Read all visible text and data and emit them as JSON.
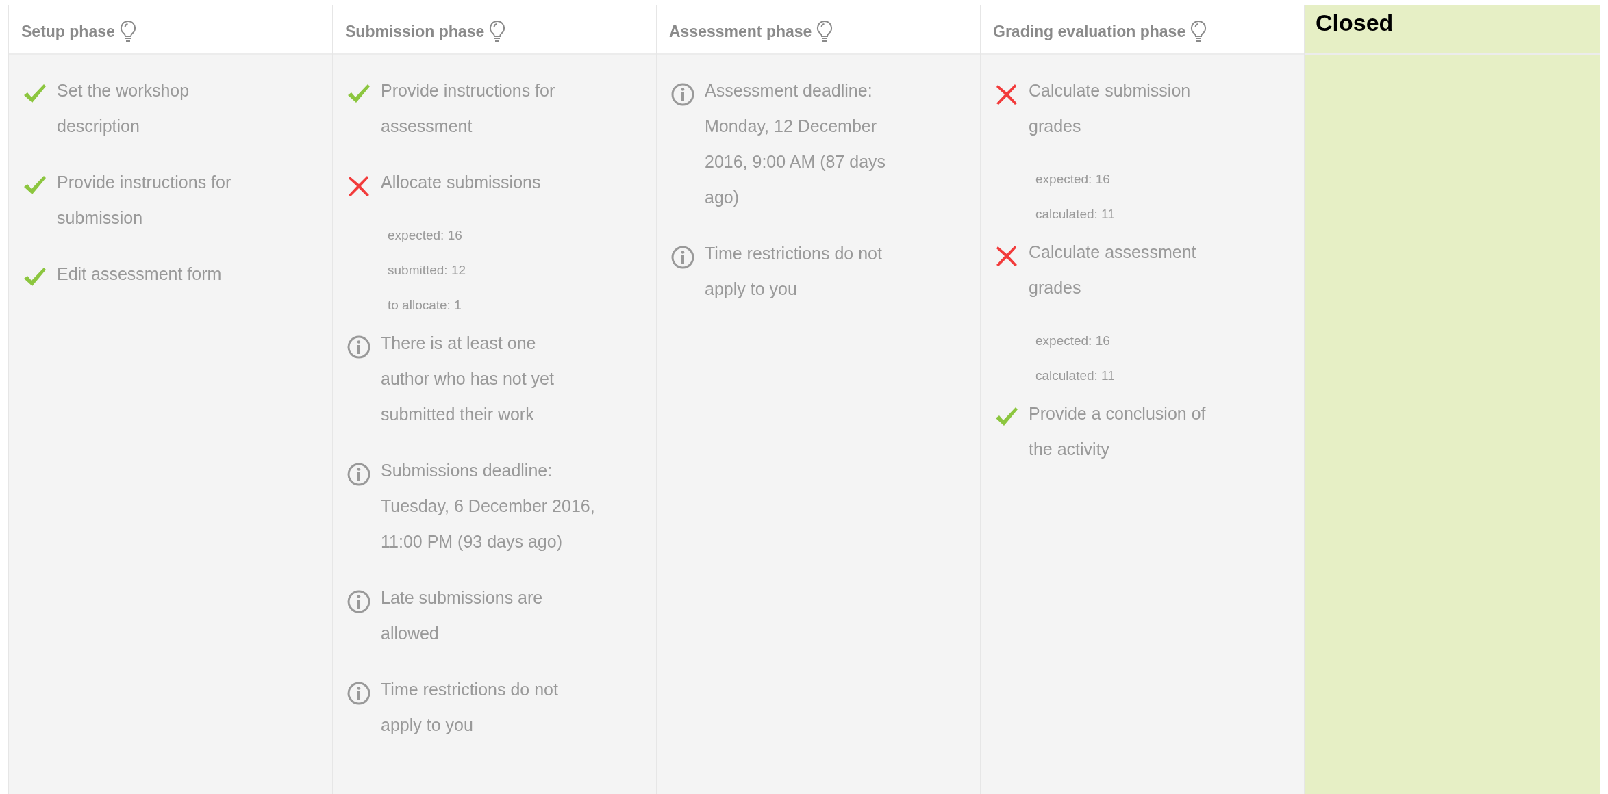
{
  "phases": [
    {
      "title": "Setup phase",
      "current": false,
      "tasks": [
        {
          "kind": "done",
          "text": "Set the workshop\ndescription"
        },
        {
          "kind": "done",
          "text": "Provide instructions for\nsubmission"
        },
        {
          "kind": "done",
          "text": "Edit assessment form"
        }
      ]
    },
    {
      "title": "Submission phase",
      "current": false,
      "tasks": [
        {
          "kind": "done",
          "text": "Provide instructions for\nassessment"
        },
        {
          "kind": "fail",
          "text": "Allocate submissions",
          "details": [
            "expected: 16",
            "submitted: 12",
            "to allocate: 1"
          ]
        },
        {
          "kind": "info",
          "text": "There is at least one\nauthor who has not yet\nsubmitted their work"
        },
        {
          "kind": "info",
          "text": "Submissions deadline:\nTuesday, 6 December 2016,\n11:00 PM (93 days ago)"
        },
        {
          "kind": "info",
          "text": "Late submissions are\nallowed"
        },
        {
          "kind": "info",
          "text": "Time restrictions do not\napply to you"
        }
      ]
    },
    {
      "title": "Assessment phase",
      "current": false,
      "tasks": [
        {
          "kind": "info",
          "text": "Assessment deadline:\nMonday, 12 December\n2016, 9:00 AM (87 days\nago)"
        },
        {
          "kind": "info",
          "text": "Time restrictions do not\napply to you"
        }
      ]
    },
    {
      "title": "Grading evaluation phase",
      "current": false,
      "tasks": [
        {
          "kind": "fail",
          "text": "Calculate submission\ngrades",
          "details": [
            "expected: 16",
            "calculated: 11"
          ]
        },
        {
          "kind": "fail",
          "text": "Calculate assessment\ngrades",
          "details": [
            "expected: 16",
            "calculated: 11"
          ]
        },
        {
          "kind": "done",
          "text": "Provide a conclusion of\nthe activity"
        }
      ]
    },
    {
      "title": "Closed",
      "current": true
    }
  ]
}
